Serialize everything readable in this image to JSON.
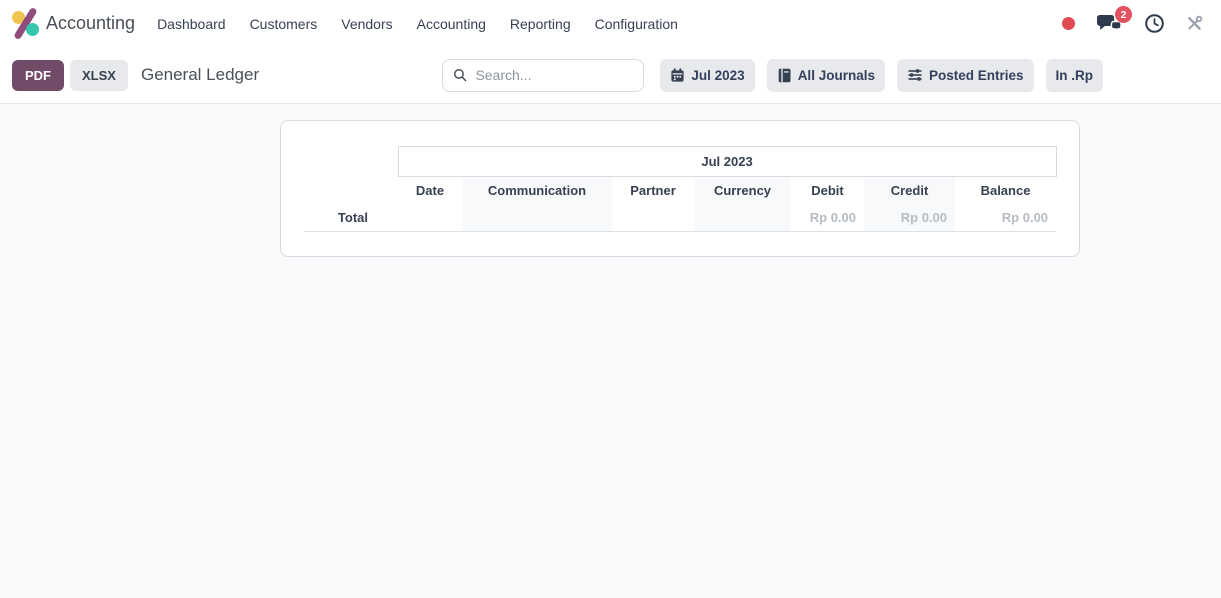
{
  "nav": {
    "brand": "Accounting",
    "items": [
      "Dashboard",
      "Customers",
      "Vendors",
      "Accounting",
      "Reporting",
      "Configuration"
    ],
    "systray": {
      "messages_badge": "2",
      "icons": [
        "recording-dot-icon",
        "messages-icon",
        "activities-clock-icon",
        "tools-icon"
      ]
    }
  },
  "toolbar": {
    "export_buttons": {
      "pdf": "PDF",
      "xlsx": "XLSX"
    },
    "title": "General Ledger",
    "search": {
      "placeholder": "Search...",
      "value": ""
    },
    "filters": [
      {
        "label": "Jul 2023",
        "icon": "calendar-icon"
      },
      {
        "label": "All Journals",
        "icon": "journal-book-icon"
      },
      {
        "label": "Posted Entries",
        "icon": "sliders-icon"
      },
      {
        "label": "In .Rp",
        "icon": ""
      }
    ]
  },
  "report": {
    "period_header": "Jul 2023",
    "columns": [
      "Date",
      "Communication",
      "Partner",
      "Currency",
      "Debit",
      "Credit",
      "Balance"
    ],
    "total_row": {
      "label": "Total",
      "debit": "Rp 0.00",
      "credit": "Rp 0.00",
      "balance": "Rp 0.00"
    }
  },
  "colors": {
    "primary_button": "#714b67",
    "filter_button_bg": "#e7e9ed",
    "body_bg": "#f8f9fa",
    "badge_red": "#e25260",
    "recording_dot_red": "#df4b50",
    "muted_amount": "#b6bcc2",
    "logo_yellow": "#efc54f",
    "logo_purple": "#8f4c7d",
    "logo_teal": "#35c7ae",
    "stripe_column_bg": "#f8f9fa"
  }
}
